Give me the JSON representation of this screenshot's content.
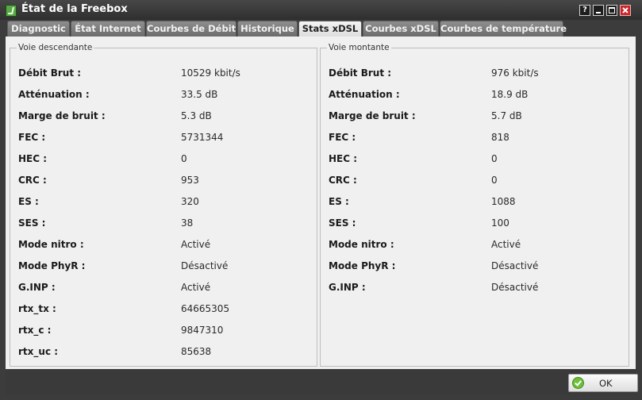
{
  "window": {
    "title": "État de la Freebox",
    "help_label": "?"
  },
  "tabs": [
    {
      "label": "Diagnostic",
      "active": false
    },
    {
      "label": "État Internet",
      "active": false
    },
    {
      "label": "Courbes de Débit",
      "active": false
    },
    {
      "label": "Historique",
      "active": false
    },
    {
      "label": "Stats xDSL",
      "active": true
    },
    {
      "label": "Courbes xDSL",
      "active": false
    },
    {
      "label": "Courbes de température",
      "active": false
    }
  ],
  "downstream": {
    "legend": "Voie descendante",
    "rows": [
      {
        "label": "Débit Brut :",
        "value": "10529 kbit/s"
      },
      {
        "label": "Atténuation :",
        "value": "33.5 dB"
      },
      {
        "label": "Marge de bruit :",
        "value": "5.3 dB"
      },
      {
        "label": "FEC :",
        "value": "5731344"
      },
      {
        "label": "HEC :",
        "value": "0"
      },
      {
        "label": "CRC :",
        "value": "953"
      },
      {
        "label": "ES :",
        "value": "320"
      },
      {
        "label": "SES :",
        "value": "38"
      },
      {
        "label": "Mode nitro :",
        "value": "Activé"
      },
      {
        "label": "Mode PhyR :",
        "value": "Désactivé"
      },
      {
        "label": "G.INP :",
        "value": "Activé"
      },
      {
        "label": "rtx_tx :",
        "value": "64665305"
      },
      {
        "label": "rtx_c :",
        "value": "9847310"
      },
      {
        "label": "rtx_uc :",
        "value": "85638"
      }
    ]
  },
  "upstream": {
    "legend": "Voie montante",
    "rows": [
      {
        "label": "Débit Brut :",
        "value": "976 kbit/s"
      },
      {
        "label": "Atténuation :",
        "value": "18.9 dB"
      },
      {
        "label": "Marge de bruit :",
        "value": "5.7 dB"
      },
      {
        "label": "FEC :",
        "value": "818"
      },
      {
        "label": "HEC :",
        "value": "0"
      },
      {
        "label": "CRC :",
        "value": "0"
      },
      {
        "label": "ES :",
        "value": "1088"
      },
      {
        "label": "SES :",
        "value": "100"
      },
      {
        "label": "Mode nitro :",
        "value": "Activé"
      },
      {
        "label": "Mode PhyR :",
        "value": "Désactivé"
      },
      {
        "label": "G.INP :",
        "value": "Désactivé"
      }
    ]
  },
  "footer": {
    "ok_label": "OK"
  },
  "colors": {
    "titlebar": "#3a3a3a",
    "content_bg": "#f0f0f0",
    "close_button": "#c8282c",
    "ok_icon": "#6fbf3a"
  }
}
